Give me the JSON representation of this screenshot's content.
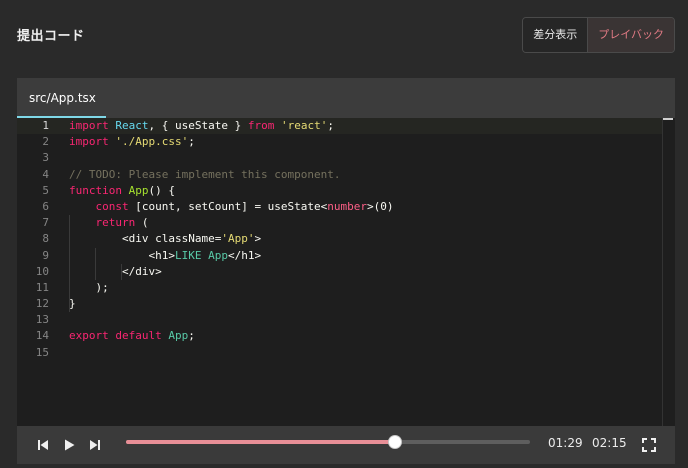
{
  "header": {
    "title": "提出コード",
    "view_toggle": [
      {
        "label": "差分表示",
        "active": false
      },
      {
        "label": "プレイバック",
        "active": true
      }
    ]
  },
  "editor": {
    "tab_label": "src/App.tsx",
    "current_line": 1,
    "lines": [
      {
        "n": "1",
        "tokens": [
          {
            "t": "import",
            "c": "kw"
          },
          {
            "t": " React",
            "c": "id"
          },
          {
            "t": ", { useState } ",
            "c": "pl"
          },
          {
            "t": "from",
            "c": "kw"
          },
          {
            "t": " 'react'",
            "c": "str"
          },
          {
            "t": ";",
            "c": "pl"
          }
        ]
      },
      {
        "n": "2",
        "tokens": [
          {
            "t": "import",
            "c": "kw"
          },
          {
            "t": " './App.css'",
            "c": "str"
          },
          {
            "t": ";",
            "c": "pl"
          }
        ]
      },
      {
        "n": "3",
        "tokens": []
      },
      {
        "n": "4",
        "tokens": [
          {
            "t": "// TODO: Please implement this component.",
            "c": "cm"
          }
        ]
      },
      {
        "n": "5",
        "tokens": [
          {
            "t": "function",
            "c": "kw"
          },
          {
            "t": " App",
            "c": "fn"
          },
          {
            "t": "() {",
            "c": "pl"
          }
        ]
      },
      {
        "n": "6",
        "tokens": [
          {
            "t": "    const",
            "c": "kw"
          },
          {
            "t": " [count, setCount] = useState<",
            "c": "pl"
          },
          {
            "t": "number",
            "c": "ty"
          },
          {
            "t": ">(0)",
            "c": "pl"
          }
        ]
      },
      {
        "n": "7",
        "tokens": [
          {
            "t": "    return",
            "c": "kw"
          },
          {
            "t": " (",
            "c": "pl"
          }
        ]
      },
      {
        "n": "8",
        "tokens": [
          {
            "t": "        <div className=",
            "c": "pl"
          },
          {
            "t": "'App'",
            "c": "str"
          },
          {
            "t": ">",
            "c": "pl"
          }
        ]
      },
      {
        "n": "9",
        "tokens": [
          {
            "t": "            <h1>",
            "c": "pl"
          },
          {
            "t": "LIKE App",
            "c": "cl"
          },
          {
            "t": "</h1>",
            "c": "pl"
          }
        ]
      },
      {
        "n": "10",
        "tokens": [
          {
            "t": "        </div>",
            "c": "pl"
          }
        ]
      },
      {
        "n": "11",
        "tokens": [
          {
            "t": "    );",
            "c": "pl"
          }
        ]
      },
      {
        "n": "12",
        "tokens": [
          {
            "t": "}",
            "c": "pl"
          }
        ]
      },
      {
        "n": "13",
        "tokens": []
      },
      {
        "n": "14",
        "tokens": [
          {
            "t": "export",
            "c": "kw"
          },
          {
            "t": " default",
            "c": "kw"
          },
          {
            "t": " App",
            "c": "cl"
          },
          {
            "t": ";",
            "c": "pl"
          }
        ]
      },
      {
        "n": "15",
        "tokens": []
      }
    ]
  },
  "player": {
    "controls": [
      {
        "icon": "skip-previous-icon"
      },
      {
        "icon": "play-icon"
      },
      {
        "icon": "skip-next-icon"
      }
    ],
    "progress_fraction": 0.667,
    "current_time": "01:29",
    "total_time": "02:15",
    "fullscreen_icon": "fullscreen-icon",
    "progress_color": "#e88f97"
  }
}
